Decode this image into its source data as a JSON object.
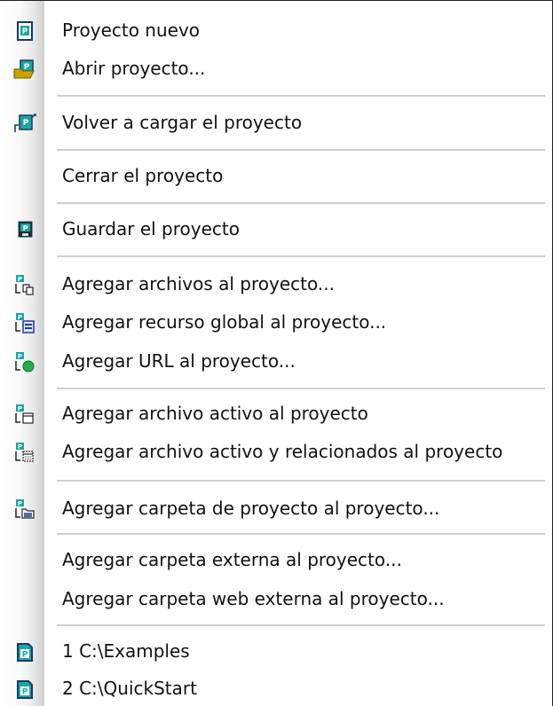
{
  "menu": {
    "items": [
      {
        "label": "Proyecto nuevo",
        "icon": "new-project-icon"
      },
      {
        "label": "Abrir proyecto...",
        "icon": "open-project-icon"
      },
      {
        "label": "Volver a cargar el proyecto",
        "icon": "reload-project-icon"
      },
      {
        "label": "Cerrar el proyecto",
        "icon": ""
      },
      {
        "label": "Guardar el proyecto",
        "icon": "save-project-icon"
      },
      {
        "label": "Agregar archivos al proyecto...",
        "icon": "add-files-icon"
      },
      {
        "label": "Agregar recurso global al proyecto...",
        "icon": "add-global-resource-icon"
      },
      {
        "label": "Agregar URL al proyecto...",
        "icon": "add-url-icon"
      },
      {
        "label": "Agregar archivo activo al proyecto",
        "icon": "add-active-file-icon"
      },
      {
        "label": "Agregar archivo activo y relacionados al proyecto",
        "icon": "add-active-related-icon"
      },
      {
        "label": "Agregar carpeta de proyecto al proyecto...",
        "icon": "add-project-folder-icon"
      },
      {
        "label": "Agregar carpeta externa al proyecto...",
        "icon": ""
      },
      {
        "label": "Agregar carpeta web externa al proyecto...",
        "icon": ""
      },
      {
        "label": "1 C:\\Examples",
        "icon": "recent-project-icon"
      },
      {
        "label": "2 C:\\QuickStart",
        "icon": "recent-project-icon"
      }
    ]
  },
  "colors": {
    "teal": "#1aa7a0",
    "navy": "#123a6b",
    "folder": "#c9a400",
    "green": "#1fb24a",
    "separator": "#cfcfcf"
  }
}
